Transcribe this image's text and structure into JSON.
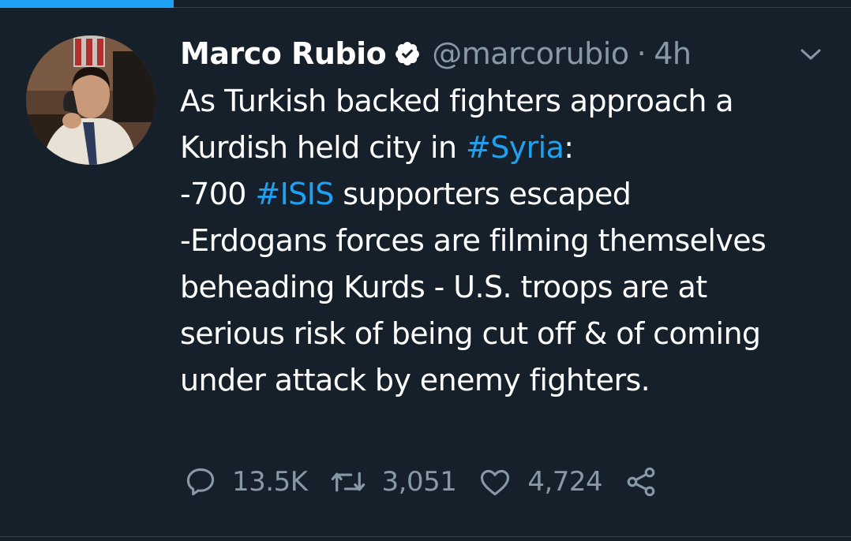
{
  "author": {
    "name": "Marco Rubio",
    "handle": "@marcorubio",
    "separator": "·",
    "time": "4h",
    "verified": true,
    "avatar_icon": "profile-photo"
  },
  "tweet": {
    "line1": "As Turkish backed fighters approach a",
    "line2_pre": "Kurdish held city in ",
    "hashtag_syria": "#Syria",
    "line2_post": ":",
    "line3_pre": "-700 ",
    "hashtag_isis": "#ISIS",
    "line3_post": " supporters escaped",
    "line4": "-Erdogans forces are filming themselves",
    "line5": "beheading Kurds - U.S. troops are at",
    "line6": "serious risk of being cut off & of coming",
    "line7": "under attack by enemy fighters."
  },
  "actions": {
    "reply_count": "13.5K",
    "retweet_count": "3,051",
    "like_count": "4,724",
    "reply_icon": "reply-icon",
    "retweet_icon": "retweet-icon",
    "like_icon": "heart-icon",
    "share_icon": "share-icon"
  },
  "colors": {
    "background": "#15202b",
    "accent": "#1da1f2",
    "secondary_text": "#8899a6",
    "primary_text": "#ffffff"
  }
}
